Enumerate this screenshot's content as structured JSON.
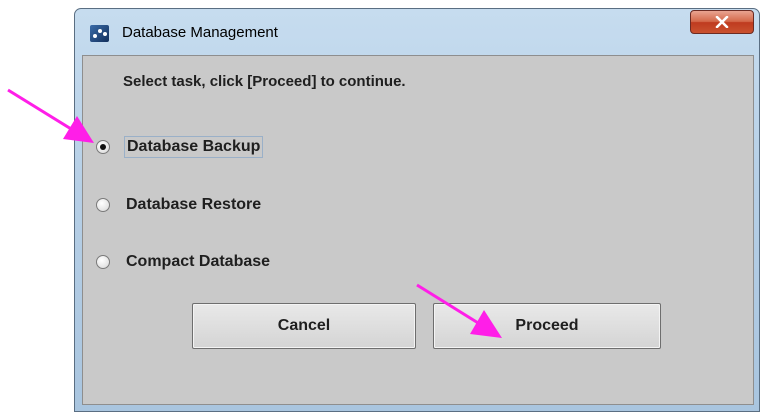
{
  "window": {
    "title": "Database Management"
  },
  "dialog": {
    "heading": "Select task, click [Proceed] to continue.",
    "options": [
      {
        "label": "Database Backup",
        "checked": true
      },
      {
        "label": "Database Restore",
        "checked": false
      },
      {
        "label": "Compact Database",
        "checked": false
      }
    ],
    "buttons": {
      "cancel": "Cancel",
      "proceed": "Proceed"
    }
  },
  "colors": {
    "annotation_arrow": "#ff1ee8",
    "close_button": "#c9512f"
  },
  "icons": [
    "app-icon",
    "close-icon",
    "annotation-arrow"
  ]
}
